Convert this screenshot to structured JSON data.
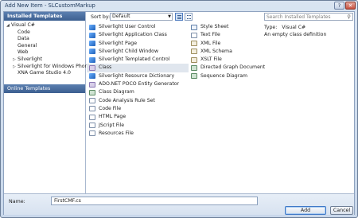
{
  "window": {
    "title": "Add New Item - SLCustomMarkup"
  },
  "left_pane": {
    "header": "Installed Templates",
    "tree": [
      {
        "label": "Visual C#",
        "level": 0,
        "expanded": true
      },
      {
        "label": "Code",
        "level": 1
      },
      {
        "label": "Data",
        "level": 1
      },
      {
        "label": "General",
        "level": 1
      },
      {
        "label": "Web",
        "level": 1
      },
      {
        "label": "Silverlight",
        "level": 1,
        "expandable": true
      },
      {
        "label": "Silverlight for Windows Phone",
        "level": 1,
        "expandable": true
      },
      {
        "label": "XNA Game Studio 4.0",
        "level": 1
      }
    ],
    "online_header": "Online Templates"
  },
  "sort": {
    "label": "Sort by:",
    "value": "Default"
  },
  "search": {
    "placeholder": "Search Installed Templates"
  },
  "templates": {
    "column1": [
      {
        "name": "Silverlight User Control",
        "icon": "silverlight-icon"
      },
      {
        "name": "Silverlight Application Class",
        "icon": "silverlight-icon"
      },
      {
        "name": "Silverlight Page",
        "icon": "silverlight-icon"
      },
      {
        "name": "Silverlight Child Window",
        "icon": "silverlight-icon"
      },
      {
        "name": "Silverlight Templated Control",
        "icon": "silverlight-icon"
      },
      {
        "name": "Class",
        "icon": "class-icon",
        "selected": true
      },
      {
        "name": "Silverlight Resource Dictionary",
        "icon": "silverlight-icon"
      },
      {
        "name": "ADO.NET POCO Entity Generator",
        "icon": "class-icon"
      },
      {
        "name": "Class Diagram",
        "icon": "diagram-icon"
      },
      {
        "name": "Code Analysis Rule Set",
        "icon": "document-icon"
      },
      {
        "name": "Code File",
        "icon": "document-icon"
      },
      {
        "name": "HTML Page",
        "icon": "document-icon"
      },
      {
        "name": "JScript File",
        "icon": "document-icon"
      },
      {
        "name": "Resources File",
        "icon": "document-icon"
      }
    ],
    "column2": [
      {
        "name": "Style Sheet",
        "icon": "css-icon"
      },
      {
        "name": "Text File",
        "icon": "document-icon"
      },
      {
        "name": "XML File",
        "icon": "xml-icon"
      },
      {
        "name": "XML Schema",
        "icon": "xml-icon"
      },
      {
        "name": "XSLT File",
        "icon": "xml-icon"
      },
      {
        "name": "Directed Graph Document",
        "icon": "diagram-icon"
      },
      {
        "name": "Sequence Diagram",
        "icon": "diagram-icon"
      }
    ]
  },
  "details": {
    "type_label": "Type:",
    "type_value": "Visual C#",
    "description": "An empty class definition"
  },
  "bottom": {
    "name_label": "Name:",
    "name_value": "FirstCMF.cs",
    "add_label": "Add",
    "cancel_label": "Cancel"
  },
  "colors": {
    "header_blue": "#3c5f90",
    "selection": "#e0e6ee",
    "frame": "#c8d7ea"
  }
}
